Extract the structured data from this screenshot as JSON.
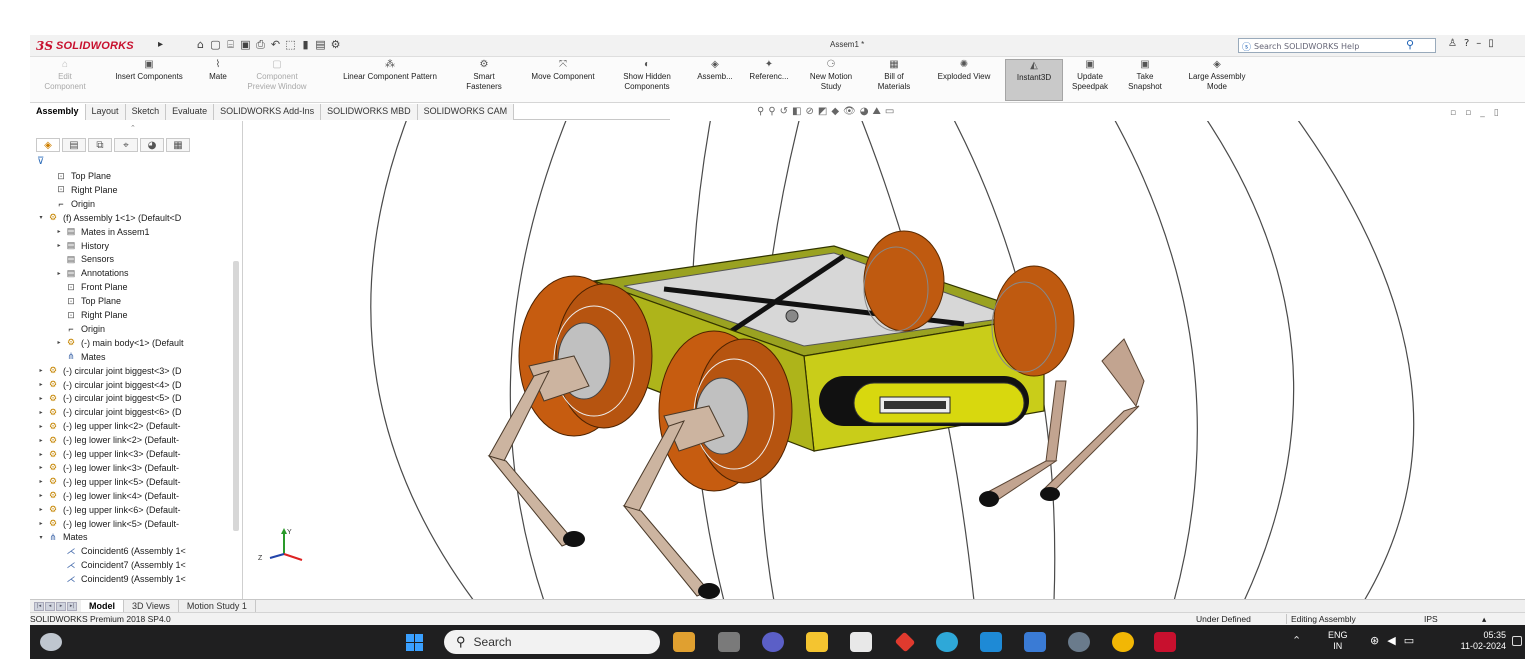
{
  "app": {
    "logo_prefix": "3S",
    "logo_name": "SOLIDWORKS",
    "document_title": "Assem1 *",
    "search_placeholder": "Search SOLIDWORKS Help"
  },
  "commands": [
    {
      "label1": "Edit",
      "label2": "Component",
      "icon": "edit-component-icon",
      "disabled": true
    },
    {
      "label1": "Insert Components",
      "label2": "",
      "icon": "insert-components-icon",
      "disabled": false
    },
    {
      "label1": "Mate",
      "label2": "",
      "icon": "mate-icon",
      "disabled": false
    },
    {
      "label1": "Component",
      "label2": "Preview Window",
      "icon": "component-preview-icon",
      "disabled": true
    },
    {
      "label1": "Linear Component Pattern",
      "label2": "",
      "icon": "linear-pattern-icon",
      "disabled": false
    },
    {
      "label1": "Smart",
      "label2": "Fasteners",
      "icon": "smart-fasteners-icon",
      "disabled": false
    },
    {
      "label1": "Move Component",
      "label2": "",
      "icon": "move-component-icon",
      "disabled": false
    },
    {
      "label1": "Show Hidden",
      "label2": "Components",
      "icon": "show-hidden-icon",
      "disabled": false
    },
    {
      "label1": "Assemb...",
      "label2": "",
      "icon": "assembly-features-icon",
      "disabled": false
    },
    {
      "label1": "Referenc...",
      "label2": "",
      "icon": "reference-geometry-icon",
      "disabled": false
    },
    {
      "label1": "New Motion",
      "label2": "Study",
      "icon": "motion-study-icon",
      "disabled": false
    },
    {
      "label1": "Bill of",
      "label2": "Materials",
      "icon": "bom-icon",
      "disabled": false
    },
    {
      "label1": "Exploded View",
      "label2": "",
      "icon": "exploded-view-icon",
      "disabled": false
    },
    {
      "label1": "Instant3D",
      "label2": "",
      "icon": "instant3d-icon",
      "disabled": false,
      "active": true
    },
    {
      "label1": "Update",
      "label2": "Speedpak",
      "icon": "speedpak-icon",
      "disabled": false
    },
    {
      "label1": "Take",
      "label2": "Snapshot",
      "icon": "snapshot-icon",
      "disabled": false
    },
    {
      "label1": "Large Assembly",
      "label2": "Mode",
      "icon": "large-assembly-icon",
      "disabled": false
    }
  ],
  "tabs": [
    "Assembly",
    "Layout",
    "Sketch",
    "Evaluate",
    "SOLIDWORKS Add-Ins",
    "SOLIDWORKS MBD",
    "SOLIDWORKS CAM"
  ],
  "tree": [
    {
      "label": "Top Plane",
      "icon": "plane",
      "indent": 1,
      "exp": ""
    },
    {
      "label": "Right Plane",
      "icon": "plane",
      "indent": 1,
      "exp": ""
    },
    {
      "label": "Origin",
      "icon": "origin",
      "indent": 1,
      "exp": ""
    },
    {
      "label": "(f) Assembly 1<1> (Default<D",
      "icon": "asm",
      "indent": 0,
      "exp": "▾"
    },
    {
      "label": "Mates in Assem1",
      "icon": "folder",
      "indent": 2,
      "exp": "▸"
    },
    {
      "label": "History",
      "icon": "folder",
      "indent": 2,
      "exp": "▸"
    },
    {
      "label": "Sensors",
      "icon": "folder",
      "indent": 2,
      "exp": ""
    },
    {
      "label": "Annotations",
      "icon": "folder",
      "indent": 2,
      "exp": "▸"
    },
    {
      "label": "Front Plane",
      "icon": "plane",
      "indent": 2,
      "exp": ""
    },
    {
      "label": "Top Plane",
      "icon": "plane",
      "indent": 2,
      "exp": ""
    },
    {
      "label": "Right Plane",
      "icon": "plane",
      "indent": 2,
      "exp": ""
    },
    {
      "label": "Origin",
      "icon": "origin",
      "indent": 2,
      "exp": ""
    },
    {
      "label": "(-) main body<1> (Default",
      "icon": "part",
      "indent": 2,
      "exp": "▸"
    },
    {
      "label": "Mates",
      "icon": "mate",
      "indent": 2,
      "exp": ""
    },
    {
      "label": "(-) circular joint biggest<3> (D",
      "icon": "part",
      "indent": 0,
      "exp": "▸"
    },
    {
      "label": "(-) circular joint biggest<4> (D",
      "icon": "part",
      "indent": 0,
      "exp": "▸"
    },
    {
      "label": "(-) circular joint biggest<5> (D",
      "icon": "part",
      "indent": 0,
      "exp": "▸"
    },
    {
      "label": "(-) circular joint biggest<6> (D",
      "icon": "part",
      "indent": 0,
      "exp": "▸"
    },
    {
      "label": "(-) leg upper link<2> (Default-",
      "icon": "part",
      "indent": 0,
      "exp": "▸"
    },
    {
      "label": "(-) leg lower link<2> (Default-",
      "icon": "part",
      "indent": 0,
      "exp": "▸"
    },
    {
      "label": "(-) leg upper link<3> (Default-",
      "icon": "part",
      "indent": 0,
      "exp": "▸"
    },
    {
      "label": "(-) leg lower link<3> (Default-",
      "icon": "part",
      "indent": 0,
      "exp": "▸"
    },
    {
      "label": "(-) leg upper link<5> (Default-",
      "icon": "part",
      "indent": 0,
      "exp": "▸"
    },
    {
      "label": "(-) leg lower link<4> (Default-",
      "icon": "part",
      "indent": 0,
      "exp": "▸"
    },
    {
      "label": "(-) leg upper link<6> (Default-",
      "icon": "part",
      "indent": 0,
      "exp": "▸"
    },
    {
      "label": "(-) leg lower link<5> (Default-",
      "icon": "part",
      "indent": 0,
      "exp": "▸"
    },
    {
      "label": "Mates",
      "icon": "mate",
      "indent": 0,
      "exp": "▾"
    },
    {
      "label": "Coincident6 (Assembly 1<",
      "icon": "coincident",
      "indent": 2,
      "exp": ""
    },
    {
      "label": "Coincident7 (Assembly 1<",
      "icon": "coincident",
      "indent": 2,
      "exp": ""
    },
    {
      "label": "Coincident9 (Assembly 1<",
      "icon": "coincident",
      "indent": 2,
      "exp": ""
    }
  ],
  "bottom_tabs": [
    "Model",
    "3D Views",
    "Motion Study 1"
  ],
  "status": {
    "version": "SOLIDWORKS Premium 2018 SP4.0",
    "state": "Under Defined",
    "mode": "Editing Assembly",
    "units": "IPS",
    "units_arrow": "▴"
  },
  "taskbar": {
    "search": "Search",
    "lang1": "ENG",
    "lang2": "IN",
    "time": "05:35",
    "date": "11-02-2024"
  },
  "triad": {
    "y": "Y",
    "z": "Z"
  }
}
